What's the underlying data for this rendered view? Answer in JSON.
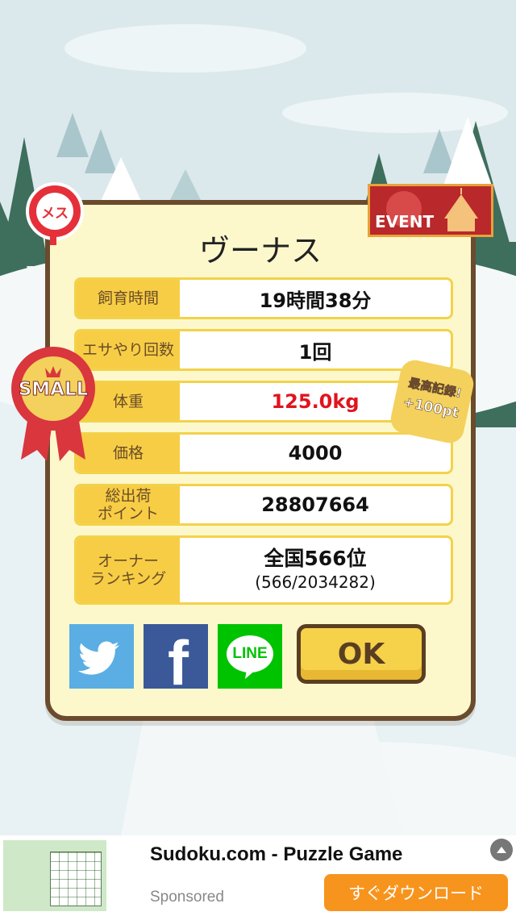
{
  "dialog": {
    "title": "ヴーナス",
    "rows": [
      {
        "label": "飼育時間",
        "value": "19時間38分"
      },
      {
        "label": "エサやり回数",
        "value": "1回"
      },
      {
        "label": "体重",
        "value": "125.0kg"
      },
      {
        "label": "価格",
        "value": "4000"
      },
      {
        "label": "総出荷\nポイント",
        "value": "28807664"
      }
    ],
    "ranking": {
      "label": "オーナー\nランキング",
      "main": "全国566位",
      "sub": "(566/2034282)"
    },
    "ok_label": "OK"
  },
  "badges": {
    "gender": "メス",
    "event": "EVENT",
    "size": "SMALL",
    "record_line1": "最高記録!",
    "record_line2": "+100pt"
  },
  "share": {
    "line_label": "LINE",
    "facebook_glyph": "f"
  },
  "ad": {
    "title": "Sudoku.com - Puzzle Game",
    "sponsored": "Sponsored",
    "download": "すぐダウンロード"
  },
  "colors": {
    "accent": "#f7cd45",
    "frame": "#6b4b2e",
    "weight_value": "#e0141e",
    "twitter": "#5aaee3",
    "facebook": "#3b5998",
    "line": "#00c300",
    "ad_button": "#f7941d"
  }
}
